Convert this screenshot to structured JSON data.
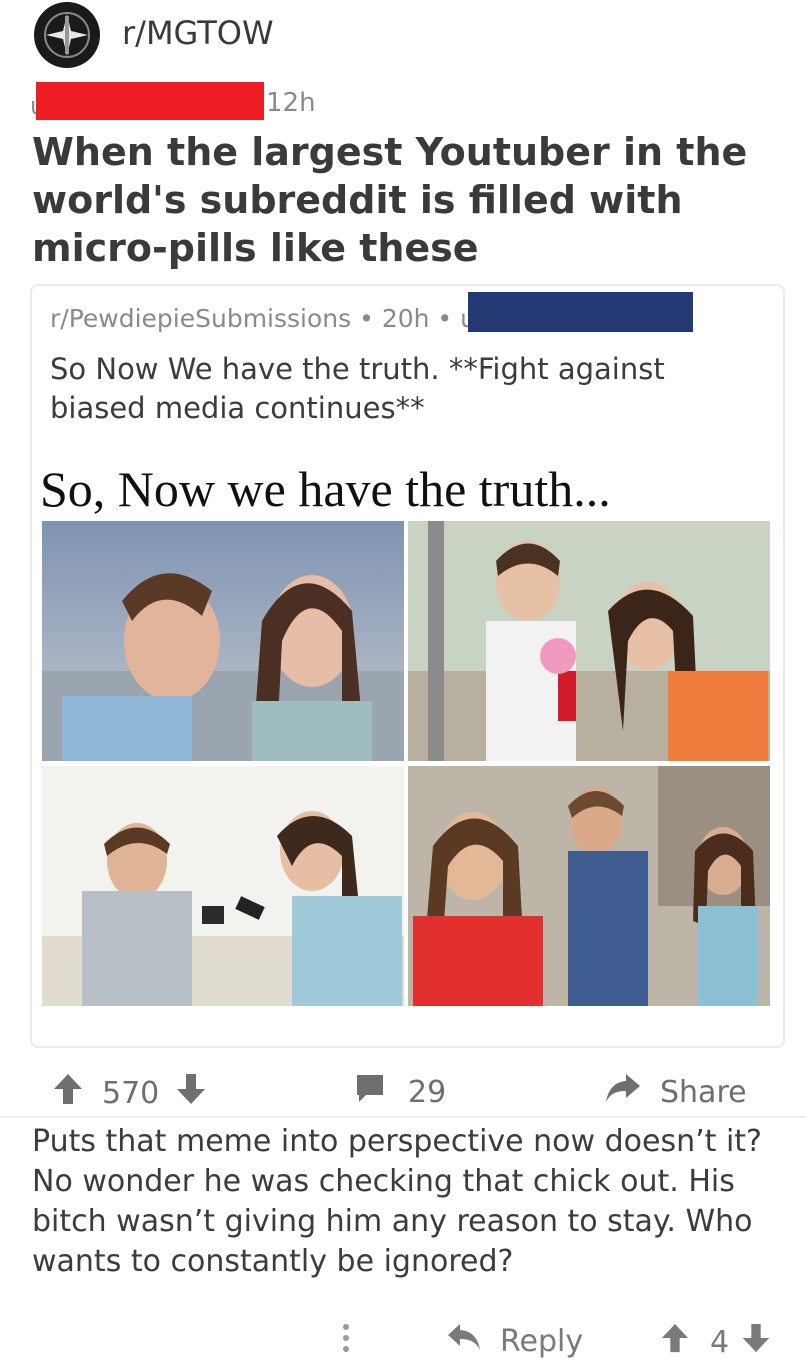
{
  "post": {
    "subreddit": "r/MGTOW",
    "username_visible": "u",
    "age": "12h",
    "title": "When the largest Youtuber in the world's subreddit is filled with micro-pills like these"
  },
  "crosspost": {
    "subreddit": "r/PewdiepieSubmissions",
    "age": "20h",
    "username_visible": "u",
    "title": "So Now We have the truth. **Fight against biased media continues**",
    "meme_caption": "So, Now we have the truth..."
  },
  "actions": {
    "score": "570",
    "comments": "29",
    "share_label": "Share"
  },
  "comment": {
    "text": "Puts that meme into perspective now doesn’t it? No wonder he was checking that chick out. His bitch wasn’t giving him any reason to stay. Who wants to constantly be ignored?",
    "reply_label": "Reply",
    "score": "4"
  },
  "colors": {
    "redaction_red": "#ee1c24",
    "redaction_blue": "#243874",
    "icon_gray": "#6f6f6f"
  },
  "icons": [
    "subreddit-avatar-icon",
    "upvote-icon",
    "downvote-icon",
    "comment-icon",
    "share-icon",
    "more-icon",
    "reply-icon"
  ]
}
